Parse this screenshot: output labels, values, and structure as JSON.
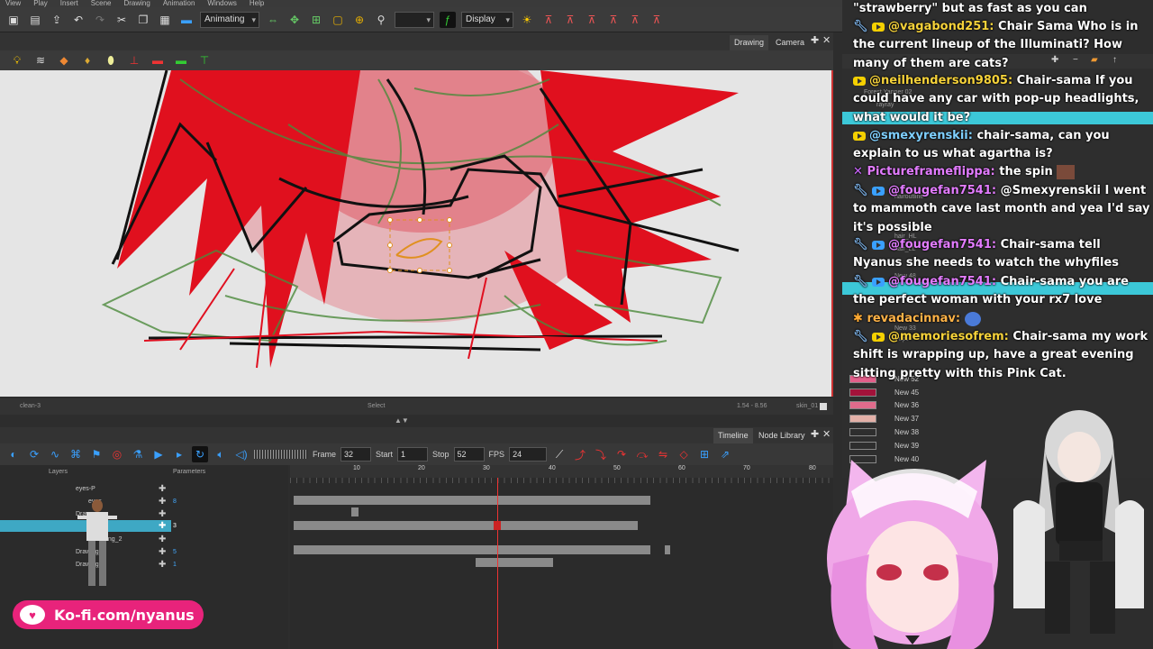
{
  "menubar": [
    "View",
    "Play",
    "Insert",
    "Scene",
    "Drawing",
    "Animation",
    "Windows",
    "Help"
  ],
  "toolbar": {
    "mode": "Animating",
    "display": "Display"
  },
  "view": {
    "tabs": [
      "Drawing",
      "Camera"
    ],
    "status_left": "clean-3",
    "status_mid": "Select",
    "status_coords": "1.54 - 8.56",
    "status_drawing": "skin_01"
  },
  "timeline": {
    "tabs": [
      "Timeline",
      "Node Library"
    ],
    "frame_label": "Frame",
    "frame": "32",
    "start_label": "Start",
    "start": "1",
    "stop_label": "Stop",
    "stop": "52",
    "fps_label": "FPS",
    "fps": "24",
    "layers_header": "Layers",
    "params_header": "Parameters",
    "ruler": [
      "10",
      "20",
      "30",
      "40",
      "50",
      "60",
      "70",
      "80"
    ],
    "layers": [
      {
        "name": "eyes-P",
        "param": ""
      },
      {
        "name": "eyes",
        "param": "8"
      },
      {
        "name": "Draw",
        "param": ""
      },
      {
        "name": "",
        "param": "3"
      },
      {
        "name": "Drawing_2",
        "param": ""
      },
      {
        "name": "Drawing_2",
        "param": "5"
      },
      {
        "name": "Drawing_3",
        "param": "1"
      }
    ]
  },
  "chat": {
    "messages": [
      {
        "user": "",
        "text": "\"strawberry\" but as fast as you can"
      },
      {
        "user": "@vagabond251:",
        "text": " Chair Sama Who is in the current lineup of the Illuminati? How many of them are cats?"
      },
      {
        "user": "@neilhenderson9805:",
        "text": " Chair-sama If you could have any car with pop-up headlights, what would it be?"
      },
      {
        "user": "@smexyrenskii:",
        "text": " chair-sama, can you explain to us what agartha is?"
      },
      {
        "user": "Pictureframeflippa:",
        "text": " the spin"
      },
      {
        "user": "@fougefan7541:",
        "text": " @Smexyrenskii I went to mammoth cave last month and yea I'd say it's possible"
      },
      {
        "user": "@fougefan7541:",
        "text": " Chair-sama tell Nyanus she needs to watch the whyfiles"
      },
      {
        "user": "@fougefan7541:",
        "text": " Chair-sama you are the perfect woman with your rx7 love"
      },
      {
        "user": "revadacinnav:",
        "text": ""
      },
      {
        "user": "@memoriesofrem:",
        "text": " Chair-sama my work shift is wrapping up, have a great evening sitting pretty with this Pink Cat."
      }
    ]
  },
  "right_panel": {
    "rows": [
      "Forest Yanner 02",
      "rayray",
      "hairoutline",
      "hair_HL",
      "hair_LL",
      "New 48",
      "New 33",
      "Pupil",
      "New 52",
      "New 45",
      "New 36",
      "New 37",
      "New 38",
      "New 39",
      "New 40"
    ]
  },
  "kofi": {
    "text": "Ko-fi.com/nyanus"
  },
  "colors": {
    "accent_red": "#d8262b",
    "highlight_cyan": "#3cc8d8",
    "kofi_pink": "#e8237b",
    "selected_layer": "#3ea8c4"
  }
}
